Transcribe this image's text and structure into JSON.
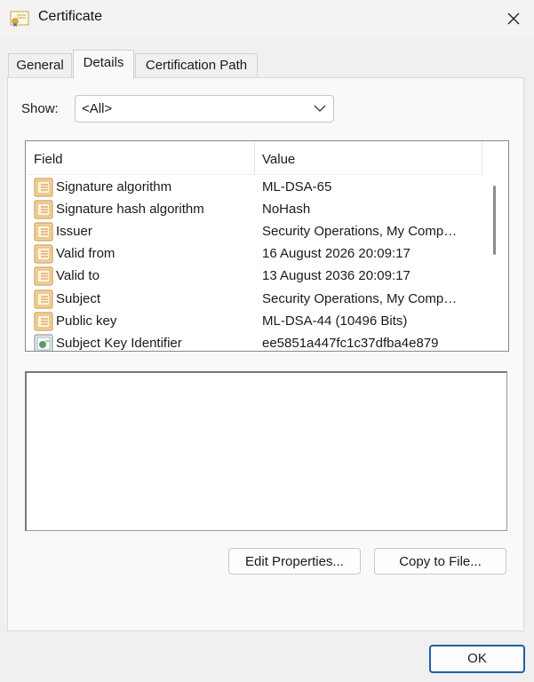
{
  "window": {
    "title": "Certificate",
    "icon": "certificate-icon"
  },
  "tabs": [
    {
      "label": "General",
      "active": false
    },
    {
      "label": "Details",
      "active": true
    },
    {
      "label": "Certification Path",
      "active": false
    }
  ],
  "show": {
    "label": "Show:",
    "value": "<All>"
  },
  "list": {
    "headers": {
      "field": "Field",
      "value": "Value"
    },
    "rows": [
      {
        "field": "Signature algorithm",
        "value": "ML-DSA-65",
        "icon": "certificate-field-icon"
      },
      {
        "field": "Signature hash algorithm",
        "value": "NoHash",
        "icon": "certificate-field-icon"
      },
      {
        "field": "Issuer",
        "value": "Security Operations, My Comp…",
        "icon": "certificate-field-icon"
      },
      {
        "field": "Valid from",
        "value": "16 August 2026 20:09:17",
        "icon": "certificate-field-icon"
      },
      {
        "field": "Valid to",
        "value": "13 August 2036 20:09:17",
        "icon": "certificate-field-icon"
      },
      {
        "field": "Subject",
        "value": "Security Operations, My Comp…",
        "icon": "certificate-field-icon"
      },
      {
        "field": "Public key",
        "value": "ML-DSA-44 (10496 Bits)",
        "icon": "certificate-field-icon"
      },
      {
        "field": "Subject Key Identifier",
        "value": "ee5851a447fc1c37dfba4e879",
        "icon": "extension-field-icon"
      }
    ]
  },
  "buttons": {
    "edit_properties": "Edit Properties...",
    "copy_to_file": "Copy to File...",
    "ok": "OK"
  },
  "colors": {
    "accent": "#1f5fa6",
    "icon_gold": "#d9a24a"
  }
}
